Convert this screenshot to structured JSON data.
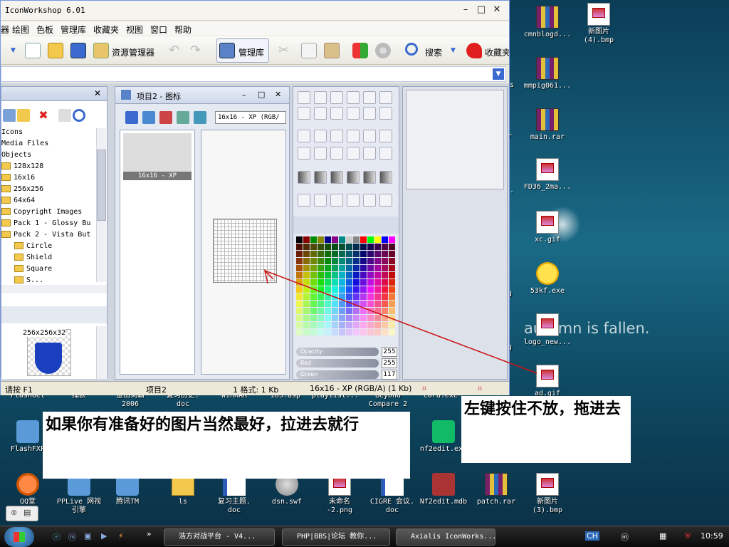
{
  "window": {
    "title": "IconWorkshop 6.01"
  },
  "menu": [
    "绘图",
    "色板",
    "管理库",
    "收藏夹",
    "视图",
    "窗口",
    "帮助"
  ],
  "menu_partial": "器",
  "toolbar": {
    "resource_manager": "资源管理器",
    "library": "管理库",
    "search": "搜索",
    "favorites": "收藏夹"
  },
  "tree": {
    "items": [
      "Icons",
      "Media Files",
      "Objects",
      "128x128",
      "16x16",
      "256x256",
      "64x64",
      "Copyright Images",
      "Pack 1 - Glossy Bu",
      "Pack 2 - Vista But",
      "Circle",
      "Shield",
      "Square",
      "S..."
    ]
  },
  "thumb": {
    "label": "256x256x32"
  },
  "project": {
    "title": "项目2 - 图标",
    "format_select": "16x16 - XP (RGB/",
    "image_label": "16x16 - XP"
  },
  "sliders": [
    {
      "label": "Opacity",
      "value": "255"
    },
    {
      "label": "Red",
      "value": "255"
    },
    {
      "label": "Green",
      "value": "117"
    }
  ],
  "status": {
    "hint": "请按 F1",
    "project": "项目2",
    "formats": "1 格式: 1 Kb",
    "current": "16x16 - XP (RGB/A) (1 Kb)"
  },
  "desktop_right": [
    {
      "label": "cmnblogd...",
      "icon": "rar-icon"
    },
    {
      "label": "新图片\n(4).bmp",
      "icon": "image-icon"
    },
    {
      "label": "mmpig061...",
      "icon": "rar-icon"
    },
    {
      "label": "main.rar",
      "icon": "rar-icon"
    },
    {
      "label": "FD36_2ma...",
      "icon": "image-icon"
    },
    {
      "label": "xc.gif",
      "icon": "image-icon"
    },
    {
      "label": "53kf.exe",
      "icon": "smiley-icon"
    },
    {
      "label": "logo_new...",
      "icon": "image-icon"
    },
    {
      "label": "ad.gif",
      "icon": "image-icon"
    }
  ],
  "desktop_bottom": [
    {
      "label": "FlashFXP",
      "icon": "flashfxp-icon"
    },
    {
      "label": "QQ堂",
      "icon": "qq-icon"
    },
    {
      "label": "PPLive 网视\n引擎",
      "icon": "pplive-icon"
    },
    {
      "label": "腾讯TM",
      "icon": "tm-icon"
    },
    {
      "label": "ls",
      "icon": "folder-icon"
    },
    {
      "label": "复习主题.\ndoc",
      "icon": "doc-icon"
    },
    {
      "label": "dsn.swf",
      "icon": "swf-icon"
    },
    {
      "label": "未命名\n-2.png",
      "icon": "png-icon"
    },
    {
      "label": "CIGRE 会议.\ndoc",
      "icon": "doc-icon"
    },
    {
      "label": "nf2edit.exe",
      "icon": "exe-icon"
    },
    {
      "label": "Nf2edit.mdb",
      "icon": "mdb-icon"
    },
    {
      "label": "patch.rar",
      "icon": "rar-icon"
    },
    {
      "label": "新图片\n(3).bmp",
      "icon": "image-icon"
    }
  ],
  "desktop_partial": [
    "FlashGet",
    "捕获",
    "金山词霸\n2006",
    "复习历史.\ndoc",
    "WinRAR",
    "103.asp",
    "playlist...",
    "Beyond\nCompare 2",
    "card.exe"
  ],
  "desktop_edge": [
    "ss",
    "r",
    "..",
    "d",
    "g"
  ],
  "wallpaper_text": "autumn is fallen.",
  "notes": {
    "left": "如果你有准备好的图片当然最好，拉进去就行",
    "right": "左键按住不放，拖进去"
  },
  "taskbar": {
    "buttons": [
      "浩方对战平台 - V4...",
      "PHP|BBS|论坛 教你...",
      "Axialis IconWorks..."
    ],
    "lang": "CH",
    "time": "10:59"
  },
  "colors": {
    "accent": "#3a6ad0",
    "arrow": "#cc1111",
    "note_bg": "#ffffff"
  }
}
